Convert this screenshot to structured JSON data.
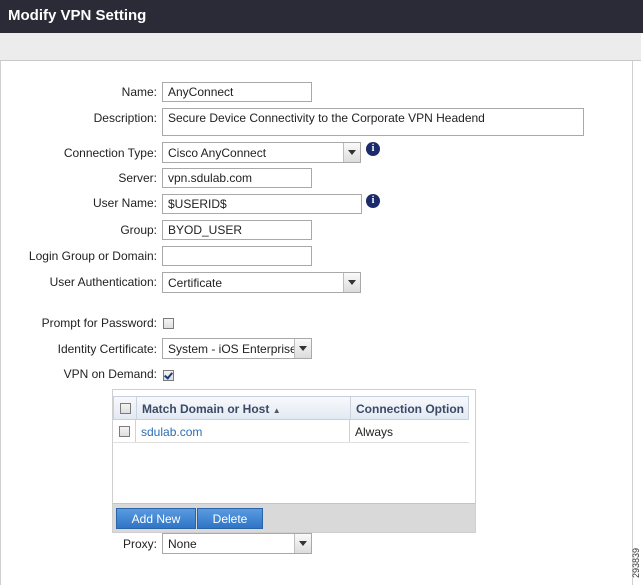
{
  "window": {
    "title": "Modify VPN Setting"
  },
  "form": {
    "name_label": "Name:",
    "name_value": "AnyConnect",
    "description_label": "Description:",
    "description_value": "Secure Device Connectivity to the Corporate VPN Headend",
    "connection_type_label": "Connection Type:",
    "connection_type_value": "Cisco AnyConnect",
    "server_label": "Server:",
    "server_value": "vpn.sdulab.com",
    "user_name_label": "User Name:",
    "user_name_value": "$USERID$",
    "group_label": "Group:",
    "group_value": "BYOD_USER",
    "login_group_label": "Login Group or Domain:",
    "login_group_value": "",
    "user_auth_label": "User Authentication:",
    "user_auth_value": "Certificate",
    "prompt_password_label": "Prompt for Password:",
    "prompt_password_checked": false,
    "identity_cert_label": "Identity Certificate:",
    "identity_cert_value": "System - iOS Enterprise",
    "vpn_on_demand_label": "VPN on Demand:",
    "vpn_on_demand_checked": true,
    "proxy_label": "Proxy:",
    "proxy_value": "None"
  },
  "vpn_table": {
    "columns": [
      "Match Domain or Host",
      "Connection Option"
    ],
    "rows": [
      {
        "domain": "sdulab.com",
        "option": "Always"
      }
    ],
    "add_label": "Add New",
    "delete_label": "Delete"
  },
  "figure_id": "293839",
  "colors": {
    "titlebar": "#2b2b37",
    "button": "#3b82d0",
    "link": "#2a6fb5",
    "info": "#1b2a6b"
  }
}
